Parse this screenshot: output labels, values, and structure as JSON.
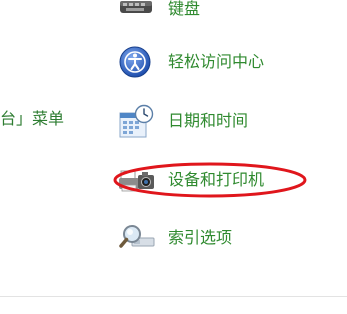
{
  "colors": {
    "link": "#2f8a2f",
    "highlight": "#e0161c",
    "background": "#ffffff"
  },
  "left_fragment": {
    "text": "台」菜单"
  },
  "items": [
    {
      "label": "键盘",
      "icon": "keyboard-icon"
    },
    {
      "label": "轻松访问中心",
      "icon": "ease-of-access-icon"
    },
    {
      "label": "日期和时间",
      "icon": "calendar-clock-icon"
    },
    {
      "label": "设备和打印机",
      "icon": "printer-camera-icon",
      "highlighted": true
    },
    {
      "label": "索引选项",
      "icon": "magnifier-icon"
    }
  ]
}
